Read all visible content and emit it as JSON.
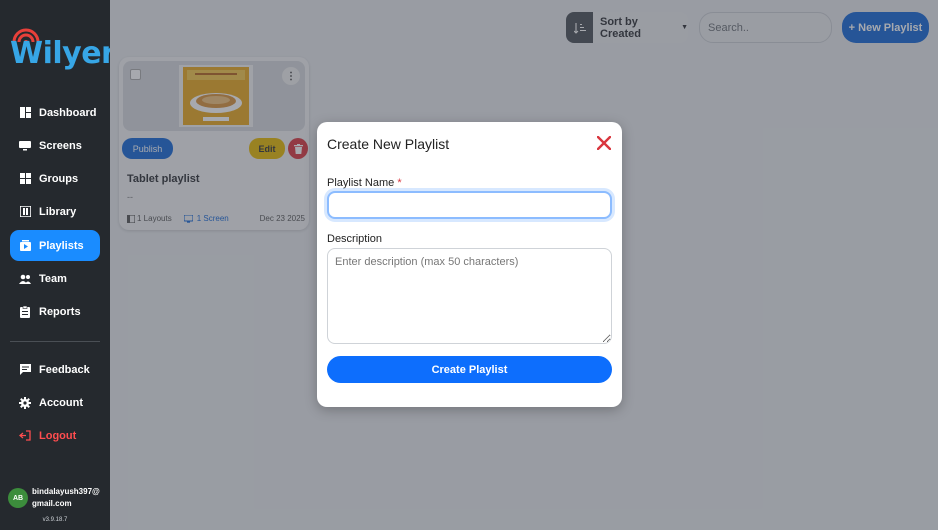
{
  "brand": {
    "name": "Wilyer",
    "dot": ".",
    "color": "#37a6e6"
  },
  "sidebar": {
    "items": [
      {
        "label": "Dashboard",
        "icon": "dashboard-icon"
      },
      {
        "label": "Screens",
        "icon": "monitor-icon"
      },
      {
        "label": "Groups",
        "icon": "grid-icon"
      },
      {
        "label": "Library",
        "icon": "library-icon"
      },
      {
        "label": "Playlists",
        "icon": "playlist-icon",
        "active": true
      },
      {
        "label": "Team",
        "icon": "team-icon"
      },
      {
        "label": "Reports",
        "icon": "reports-icon"
      },
      {
        "label": "Feedback",
        "icon": "feedback-icon"
      },
      {
        "label": "Account",
        "icon": "gear-icon"
      },
      {
        "label": "Logout",
        "icon": "logout-icon"
      }
    ],
    "user": {
      "initials": "AB",
      "email": "bindalayush397@gmail.com"
    },
    "version": "v3.9.18.7"
  },
  "toolbar": {
    "sort_label": "Sort by Created",
    "search_placeholder": "Search..",
    "new_playlist_label": "+ New Playlist"
  },
  "card": {
    "title": "Tablet playlist",
    "description": "--",
    "publish_label": "Publish",
    "edit_label": "Edit",
    "layouts": "1 Layouts",
    "screens": "1 Screen",
    "date": "Dec 23 2025"
  },
  "modal": {
    "title": "Create New Playlist",
    "name_label": "Playlist Name",
    "required_mark": "*",
    "name_value": "",
    "description_label": "Description",
    "description_placeholder": "Enter description (max 50 characters)",
    "create_label": "Create Playlist"
  },
  "colors": {
    "primary": "#1466d6",
    "active_nav": "#1a8cff",
    "edit": "#e6b800",
    "danger": "#d9363e",
    "sidebar_bg": "#25292e"
  }
}
